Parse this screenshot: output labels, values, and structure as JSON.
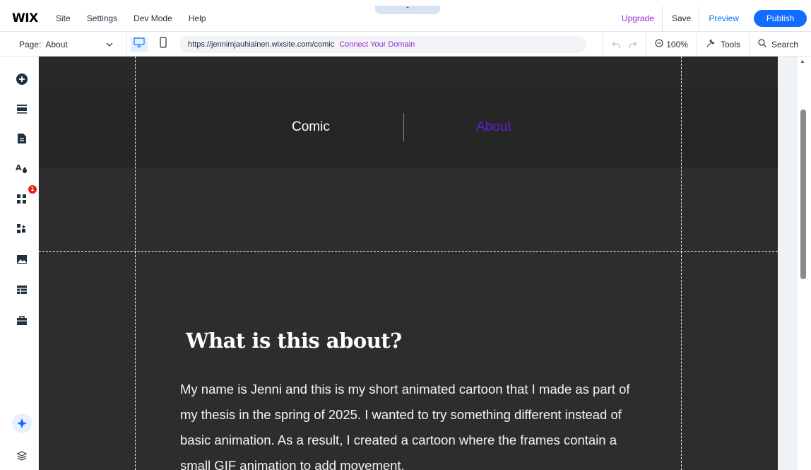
{
  "topbar": {
    "logo": "WIX",
    "menu": [
      "Site",
      "Settings",
      "Dev Mode",
      "Help"
    ],
    "upgrade": "Upgrade",
    "save": "Save",
    "preview": "Preview",
    "publish": "Publish",
    "collapse_glyph": "⌃"
  },
  "toolbar": {
    "page_label": "Page:",
    "page_value": "About",
    "url": "https://jennimjauhiainen.wixsite.com/comic",
    "connect_domain": "Connect Your Domain",
    "zoom": "100%",
    "tools": "Tools",
    "search": "Search"
  },
  "sidebar": {
    "badge_count": "1",
    "icons": [
      "add-icon",
      "sections-icon",
      "pages-icon",
      "design-icon",
      "apps-icon",
      "add-apps-icon",
      "media-icon",
      "cms-icon",
      "business-icon",
      "ai-assistant-icon",
      "layers-icon"
    ]
  },
  "canvas": {
    "nav": {
      "comic": "Comic",
      "about": "About"
    },
    "heading": "What is this about?",
    "paragraph": "My name is Jenni and this is my short animated cartoon that I made as part of my thesis in the spring of 2025. I wanted to try something different instead of basic animation. As a result, I created a cartoon where the frames contain a small GIF animation to add movement.",
    "active_link_color": "#5a1fd1"
  },
  "colors": {
    "publish": "#116dff",
    "upgrade": "#9a27d5",
    "canvas_bg": "#2d2d2d"
  }
}
